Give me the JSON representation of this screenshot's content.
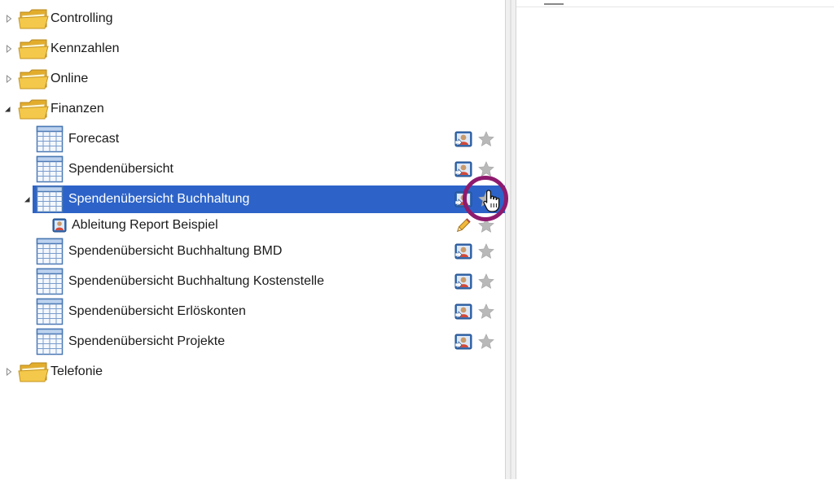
{
  "tree": {
    "folders": [
      {
        "label": "Controlling",
        "expanded": false
      },
      {
        "label": "Kennzahlen",
        "expanded": false
      },
      {
        "label": "Online",
        "expanded": false
      },
      {
        "label": "Finanzen",
        "expanded": true
      },
      {
        "label": "Telefonie",
        "expanded": false
      }
    ],
    "reports": [
      {
        "label": "Forecast"
      },
      {
        "label": "Spendenübersicht"
      },
      {
        "label": "Spendenübersicht Buchhaltung",
        "selected": true,
        "expanded": true
      },
      {
        "label": "Spendenübersicht Buchhaltung BMD"
      },
      {
        "label": "Spendenübersicht Buchhaltung Kostenstelle"
      },
      {
        "label": "Spendenübersicht Erlöskonten"
      },
      {
        "label": "Spendenübersicht Projekte"
      }
    ],
    "derived": {
      "label": "Ableitung Report Beispiel"
    }
  },
  "colors": {
    "selection": "#2d63c8",
    "highlight_ring": "#8e1a6e",
    "folder": "#f2c64a",
    "star": "#b5b5b5"
  },
  "icons": {
    "folder": "folder-icon",
    "report": "table-report-icon",
    "share": "user-share-icon",
    "favorite": "star-icon",
    "edit": "pencil-icon",
    "derived": "derived-report-icon"
  }
}
